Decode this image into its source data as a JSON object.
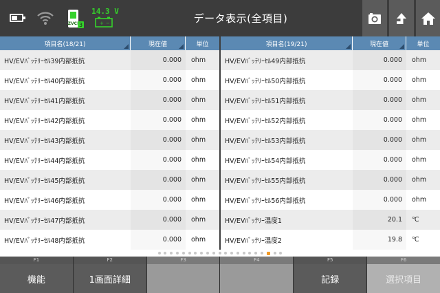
{
  "header": {
    "title": "データ表示(全項目)",
    "voltage": "14.3 V",
    "vci_label": "ZVCI",
    "vci_badge": "3",
    "colors": {
      "bar": "#3c3c3c",
      "button": "#5b5b5b",
      "voltage": "#35d12b",
      "table_header": "#5b89b3"
    }
  },
  "left_table": {
    "headers": {
      "name": "項目名(18/21)",
      "value": "現在値",
      "unit": "単位"
    },
    "rows": [
      {
        "name": "HV/EVﾊﾞｯﾃﾘｰｾﾙ39内部抵抗",
        "value": "0.000",
        "unit": "ohm"
      },
      {
        "name": "HV/EVﾊﾞｯﾃﾘｰｾﾙ40内部抵抗",
        "value": "0.000",
        "unit": "ohm"
      },
      {
        "name": "HV/EVﾊﾞｯﾃﾘｰｾﾙ41内部抵抗",
        "value": "0.000",
        "unit": "ohm"
      },
      {
        "name": "HV/EVﾊﾞｯﾃﾘｰｾﾙ42内部抵抗",
        "value": "0.000",
        "unit": "ohm"
      },
      {
        "name": "HV/EVﾊﾞｯﾃﾘｰｾﾙ43内部抵抗",
        "value": "0.000",
        "unit": "ohm"
      },
      {
        "name": "HV/EVﾊﾞｯﾃﾘｰｾﾙ44内部抵抗",
        "value": "0.000",
        "unit": "ohm"
      },
      {
        "name": "HV/EVﾊﾞｯﾃﾘｰｾﾙ45内部抵抗",
        "value": "0.000",
        "unit": "ohm"
      },
      {
        "name": "HV/EVﾊﾞｯﾃﾘｰｾﾙ46内部抵抗",
        "value": "0.000",
        "unit": "ohm"
      },
      {
        "name": "HV/EVﾊﾞｯﾃﾘｰｾﾙ47内部抵抗",
        "value": "0.000",
        "unit": "ohm"
      },
      {
        "name": "HV/EVﾊﾞｯﾃﾘｰｾﾙ48内部抵抗",
        "value": "0.000",
        "unit": "ohm"
      }
    ]
  },
  "right_table": {
    "headers": {
      "name": "項目名(19/21)",
      "value": "現在値",
      "unit": "単位"
    },
    "rows": [
      {
        "name": "HV/EVﾊﾞｯﾃﾘｰｾﾙ49内部抵抗",
        "value": "0.000",
        "unit": "ohm"
      },
      {
        "name": "HV/EVﾊﾞｯﾃﾘｰｾﾙ50内部抵抗",
        "value": "0.000",
        "unit": "ohm"
      },
      {
        "name": "HV/EVﾊﾞｯﾃﾘｰｾﾙ51内部抵抗",
        "value": "0.000",
        "unit": "ohm"
      },
      {
        "name": "HV/EVﾊﾞｯﾃﾘｰｾﾙ52内部抵抗",
        "value": "0.000",
        "unit": "ohm"
      },
      {
        "name": "HV/EVﾊﾞｯﾃﾘｰｾﾙ53内部抵抗",
        "value": "0.000",
        "unit": "ohm"
      },
      {
        "name": "HV/EVﾊﾞｯﾃﾘｰｾﾙ54内部抵抗",
        "value": "0.000",
        "unit": "ohm"
      },
      {
        "name": "HV/EVﾊﾞｯﾃﾘｰｾﾙ55内部抵抗",
        "value": "0.000",
        "unit": "ohm"
      },
      {
        "name": "HV/EVﾊﾞｯﾃﾘｰｾﾙ56内部抵抗",
        "value": "0.000",
        "unit": "ohm"
      },
      {
        "name": "HV/EVﾊﾞｯﾃﾘｰ温度1",
        "value": "20.1",
        "unit": "℃"
      },
      {
        "name": "HV/EVﾊﾞｯﾃﾘｰ温度2",
        "value": "19.8",
        "unit": "℃"
      }
    ]
  },
  "pager": {
    "total_pages": 21,
    "active_index": 18
  },
  "function_keys": [
    {
      "key": "F1",
      "label": "機能",
      "state": "active"
    },
    {
      "key": "F2",
      "label": "1画面詳細",
      "state": "active"
    },
    {
      "key": "F3",
      "label": "",
      "state": "blank"
    },
    {
      "key": "F4",
      "label": "",
      "state": "blank"
    },
    {
      "key": "F5",
      "label": "記録",
      "state": "active"
    },
    {
      "key": "F6",
      "label": "選択項目",
      "state": "disabled"
    }
  ],
  "icons": [
    "battery-icon",
    "wifi-icon",
    "zvci-icon",
    "car-battery-icon",
    "camera-icon",
    "up-arrow-icon",
    "home-icon"
  ]
}
